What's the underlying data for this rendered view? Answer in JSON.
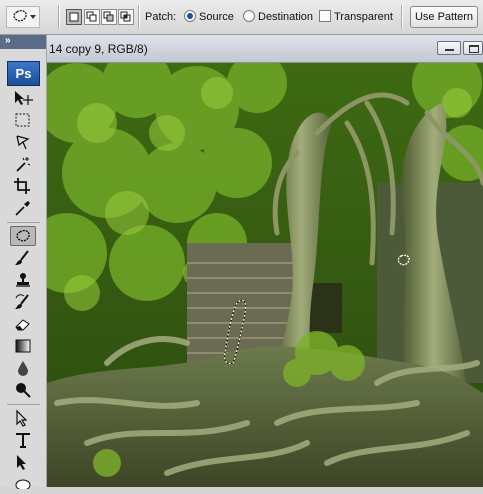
{
  "options_bar": {
    "patch_label": "Patch:",
    "source_label": "Source",
    "destination_label": "Destination",
    "transparent_label": "Transparent",
    "use_pattern_label": "Use Pattern",
    "source_selected": true,
    "transparent_checked": false
  },
  "toolbox": {
    "logo": "Ps",
    "tools": [
      "move-tool",
      "marquee-tool",
      "lasso-tool",
      "magic-wand-tool",
      "crop-tool",
      "eyedropper-tool",
      "patch-tool",
      "brush-tool",
      "stamp-tool",
      "history-brush-tool",
      "eraser-tool",
      "gradient-tool",
      "blur-tool",
      "dodge-tool",
      "path-selection-tool",
      "type-tool",
      "direct-selection-tool",
      "ellipse-tool"
    ],
    "active_tool": "patch-tool"
  },
  "document": {
    "title": "14 copy 9, RGB/8)"
  },
  "colors": {
    "accent": "#1c4f97",
    "foliage": "#5e8f1e",
    "bark": "#7d8a5a"
  }
}
